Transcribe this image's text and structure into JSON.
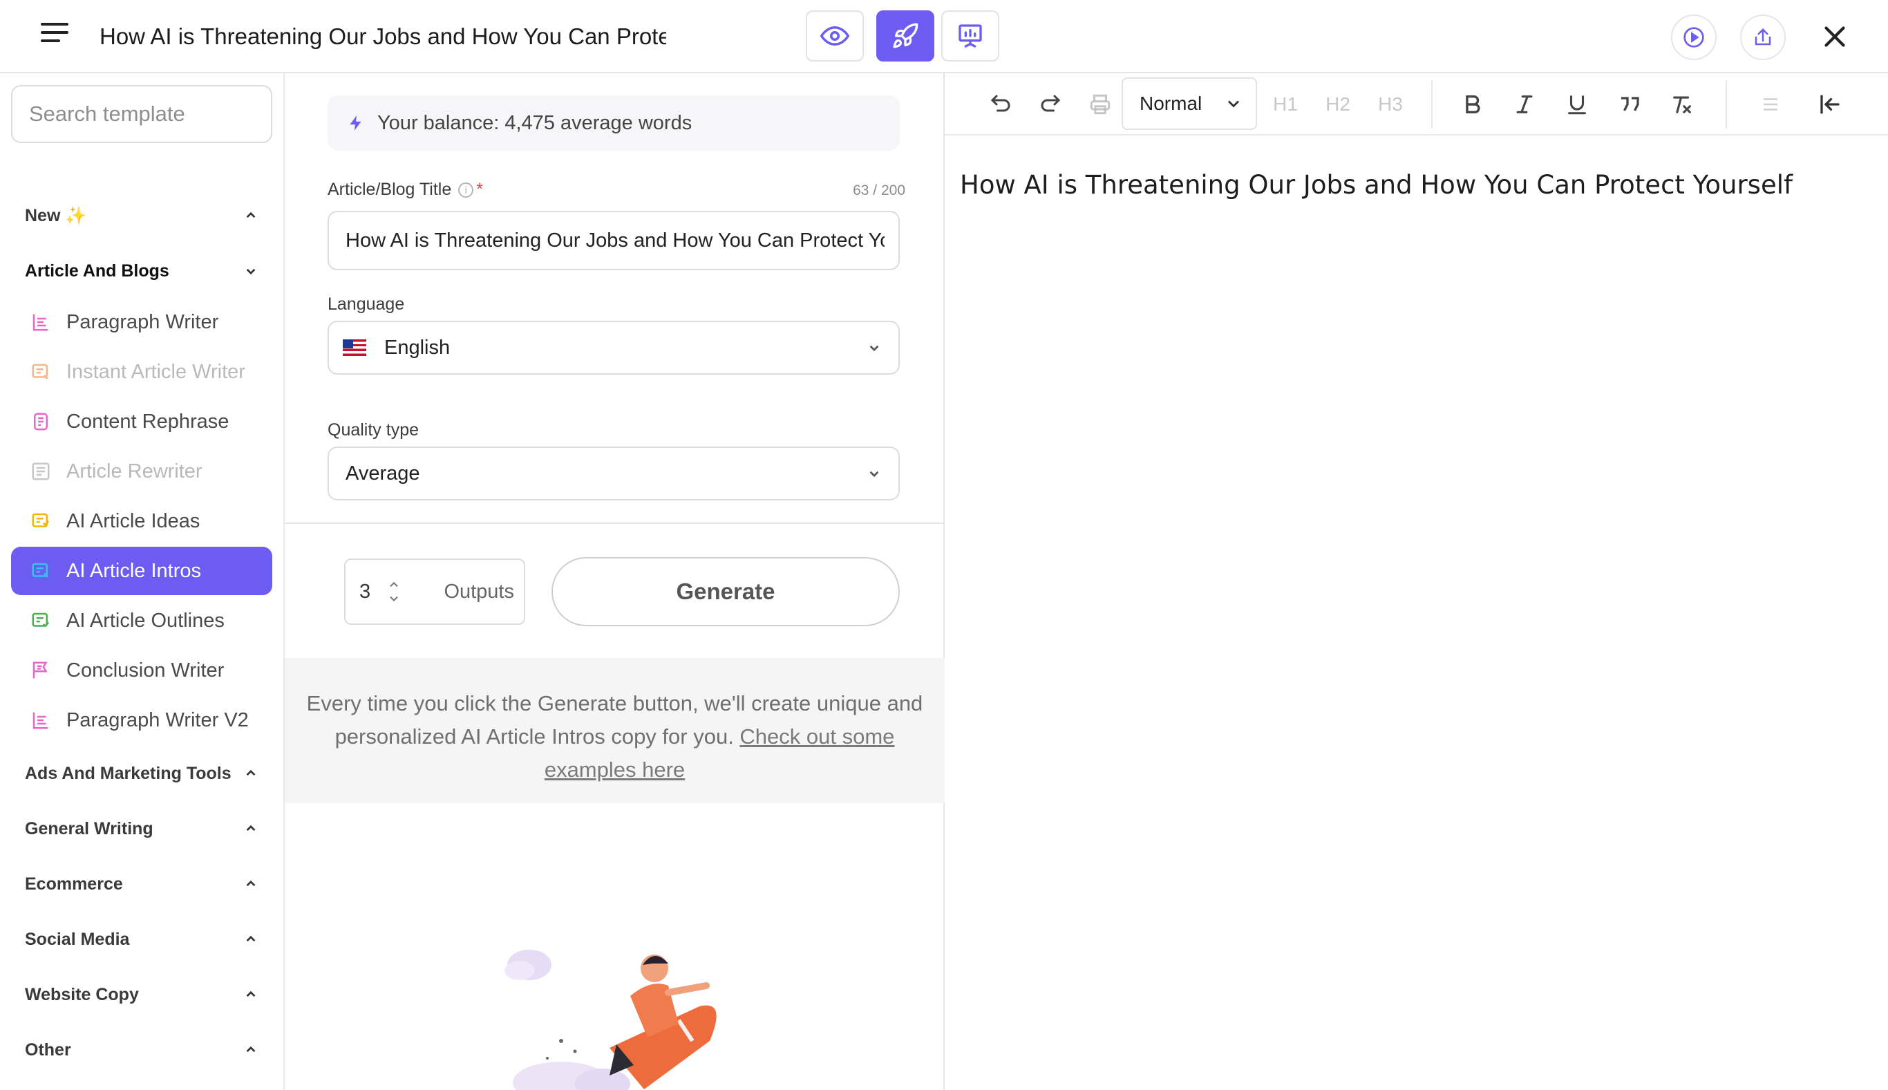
{
  "header": {
    "title": "How AI is Threatening Our Jobs and How You Can Protec",
    "modes": [
      {
        "name": "preview",
        "icon": "eye-icon"
      },
      {
        "name": "generate",
        "icon": "rocket-icon",
        "active": true
      },
      {
        "name": "presentation",
        "icon": "presentation-icon"
      }
    ],
    "accent_color": "#6c5cf2"
  },
  "sidebar": {
    "search_placeholder": "Search template",
    "categories": [
      {
        "label": "New ✨"
      },
      {
        "label": "Article And Blogs"
      },
      {
        "label": "Ads And Marketing Tools"
      },
      {
        "label": "General Writing"
      },
      {
        "label": "Ecommerce"
      },
      {
        "label": "Social Media"
      },
      {
        "label": "Website Copy"
      },
      {
        "label": "Other"
      }
    ],
    "items": [
      {
        "label": "Paragraph Writer",
        "icon": "paragraph-icon",
        "color": "#e667c8"
      },
      {
        "label": "Instant Article Writer",
        "icon": "article-icon",
        "color": "#f5b68d"
      },
      {
        "label": "Content Rephrase",
        "icon": "rephrase-icon",
        "color": "#e667c8"
      },
      {
        "label": "Article Rewriter",
        "icon": "rewrite-icon",
        "color": "#c7c7c7"
      },
      {
        "label": "AI Article Ideas",
        "icon": "ideas-icon",
        "color": "#f2b705"
      },
      {
        "label": "AI Article Intros",
        "icon": "intro-icon",
        "color": "#35c3e8"
      },
      {
        "label": "AI Article Outlines",
        "icon": "outline-icon",
        "color": "#4caf50"
      },
      {
        "label": "Conclusion Writer",
        "icon": "flag-icon",
        "color": "#e667c8"
      },
      {
        "label": "Paragraph Writer V2",
        "icon": "paragraph-icon",
        "color": "#e667c8"
      }
    ]
  },
  "form": {
    "balance_text": "Your balance: 4,475 average words",
    "title_label": "Article/Blog Title",
    "title_required": "*",
    "title_counter": "63 / 200",
    "title_value": "How AI is Threatening Our Jobs and How You Can Protect Yourself",
    "language_label": "Language",
    "language_value": "English",
    "quality_label": "Quality type",
    "quality_value": "Average",
    "outputs_value": "3",
    "outputs_label": "Outputs",
    "generate_label": "Generate",
    "note_text": "Every time you click the Generate button, we'll create unique and personalized AI Article Intros copy for you. ",
    "note_link": "Check out some examples here"
  },
  "editor": {
    "block_style": "Normal",
    "headings": [
      "H1",
      "H2",
      "H3"
    ],
    "content": "How AI is Threatening Our Jobs and How You Can Protect Yourself"
  }
}
